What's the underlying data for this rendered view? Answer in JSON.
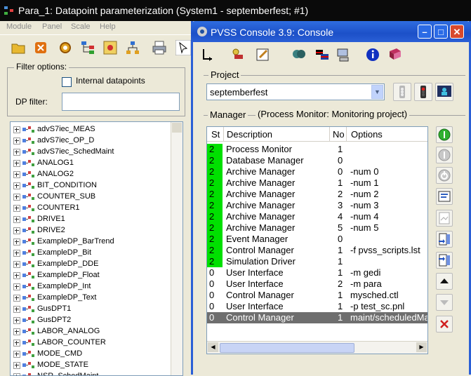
{
  "back_window": {
    "title": "Para_1: Datapoint parameterization (System1 - septemberfest; #1)",
    "menu": [
      "Module",
      "Panel",
      "Scale",
      "Help"
    ],
    "filter": {
      "section_label": "Filter options:",
      "internal_label": "Internal datapoints",
      "dp_filter_label": "DP filter:",
      "dp_filter_value": ""
    },
    "tree_items": [
      "advS7iec_MEAS",
      "advS7iec_OP_D",
      "advS7iec_SchedMaint",
      "ANALOG1",
      "ANALOG2",
      "BIT_CONDITION",
      "COUNTER_SUB",
      "COUNTER1",
      "DRIVE1",
      "DRIVE2",
      "ExampleDP_BarTrend",
      "ExampleDP_Bit",
      "ExampleDP_DDE",
      "ExampleDP_Float",
      "ExampleDP_Int",
      "ExampleDP_Text",
      "GusDPT1",
      "GusDPT2",
      "LABOR_ANALOG",
      "LABOR_COUNTER",
      "MODE_CMD",
      "MODE_STATE",
      "NSR_SchedMaint"
    ]
  },
  "console": {
    "title": "PVSS Console 3.9: Console",
    "window_buttons": {
      "minimize": "–",
      "maximize": "□",
      "close": "✕"
    },
    "project": {
      "section_label": "Project",
      "selected": "septemberfest",
      "arrow": "▼"
    },
    "manager": {
      "section_label": "Manager",
      "status_text": "(Process Monitor: Monitoring project)",
      "columns": [
        "St",
        "Description",
        "No",
        "Options"
      ],
      "rows": [
        {
          "st": "2",
          "desc": "Process Monitor",
          "no": "1",
          "opt": "",
          "green": true
        },
        {
          "st": "2",
          "desc": "Database Manager",
          "no": "0",
          "opt": "",
          "green": true
        },
        {
          "st": "2",
          "desc": "Archive Manager",
          "no": "0",
          "opt": "-num 0",
          "green": true
        },
        {
          "st": "2",
          "desc": "Archive Manager",
          "no": "1",
          "opt": "-num 1",
          "green": true
        },
        {
          "st": "2",
          "desc": "Archive Manager",
          "no": "2",
          "opt": "-num 2",
          "green": true
        },
        {
          "st": "2",
          "desc": "Archive Manager",
          "no": "3",
          "opt": "-num 3",
          "green": true
        },
        {
          "st": "2",
          "desc": "Archive Manager",
          "no": "4",
          "opt": "-num 4",
          "green": true
        },
        {
          "st": "2",
          "desc": "Archive Manager",
          "no": "5",
          "opt": "-num 5",
          "green": true
        },
        {
          "st": "2",
          "desc": "Event Manager",
          "no": "0",
          "opt": "",
          "green": true
        },
        {
          "st": "2",
          "desc": "Control Manager",
          "no": "1",
          "opt": "-f pvss_scripts.lst",
          "green": true
        },
        {
          "st": "2",
          "desc": "Simulation Driver",
          "no": "1",
          "opt": "",
          "green": true
        },
        {
          "st": "0",
          "desc": "User Interface",
          "no": "1",
          "opt": "-m gedi",
          "green": false
        },
        {
          "st": "0",
          "desc": "User Interface",
          "no": "2",
          "opt": "-m para",
          "green": false
        },
        {
          "st": "0",
          "desc": "Control Manager",
          "no": "1",
          "opt": "mysched.ctl",
          "green": false
        },
        {
          "st": "0",
          "desc": "User Interface",
          "no": "1",
          "opt": "-p test_sc.pnl",
          "green": false
        },
        {
          "st": "0",
          "desc": "Control Manager",
          "no": "1",
          "opt": "maint/scheduledMa",
          "green": false,
          "selected": true
        }
      ]
    },
    "colors": {
      "running": "#00e000",
      "selected_row": "#6e6e6e",
      "title_blue": "#1c50c8"
    }
  }
}
